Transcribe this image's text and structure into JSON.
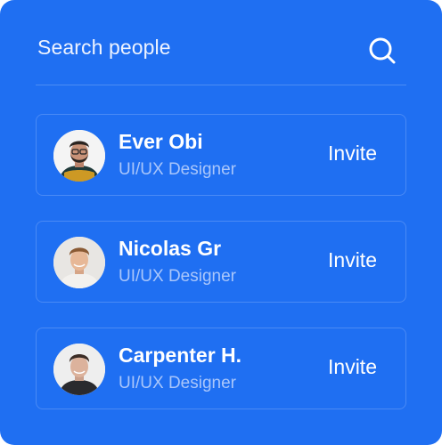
{
  "search": {
    "placeholder": "Search people",
    "icon": "search-icon"
  },
  "colors": {
    "background": "#1f6ff2",
    "card_border": "#4a8af5",
    "text": "#ffffff",
    "secondary_text": "#a9c6fb"
  },
  "people": [
    {
      "name": "Ever Obi",
      "role": "UI/UX Designer",
      "action": "Invite"
    },
    {
      "name": "Nicolas Gr",
      "role": "UI/UX Designer",
      "action": "Invite"
    },
    {
      "name": "Carpenter H.",
      "role": "UI/UX Designer",
      "action": "Invite"
    }
  ]
}
